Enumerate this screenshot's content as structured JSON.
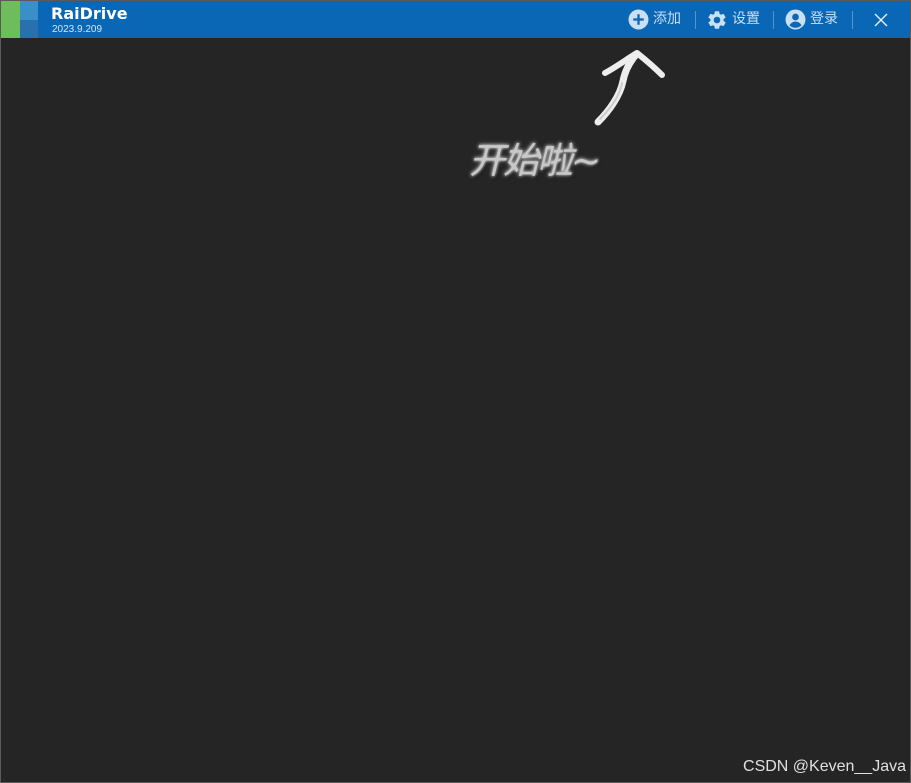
{
  "app": {
    "name": "RaiDrive",
    "version": "2023.9.209"
  },
  "toolbar": {
    "add_label": "添加",
    "settings_label": "设置",
    "login_label": "登录"
  },
  "icons": {
    "add": "plus-circle-icon",
    "settings": "gear-icon",
    "login": "user-circle-icon",
    "close": "close-icon",
    "logo": "raidrive-logo-icon"
  },
  "annotation": {
    "text": "开始啦~"
  },
  "watermark": {
    "text": "CSDN @Keven__Java"
  },
  "colors": {
    "titlebar": "#0a67b5",
    "background": "#252525",
    "logo_green": "#6dbe5a",
    "logo_teal": "#3a8fc9",
    "logo_dark": "#1f5f99"
  }
}
